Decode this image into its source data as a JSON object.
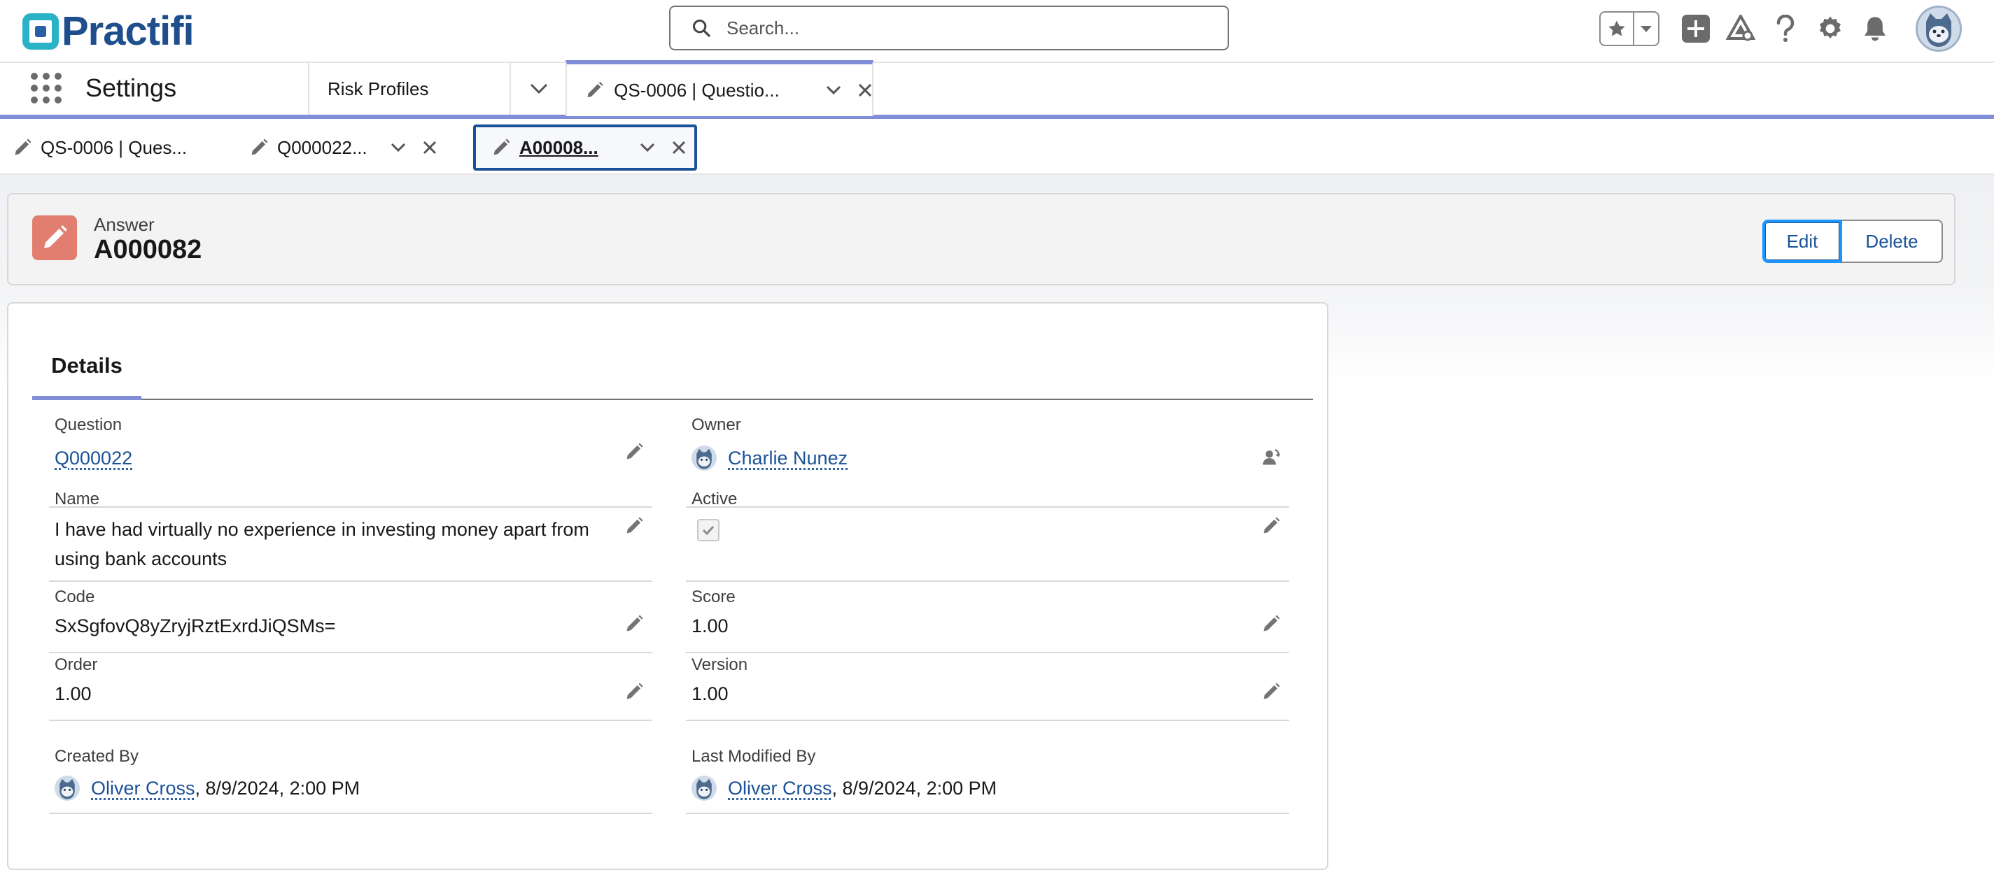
{
  "header": {
    "logo_text": "Practifi",
    "search": {
      "placeholder": "Search..."
    },
    "icons": [
      "favorites-star-icon",
      "favorites-dropdown-icon",
      "global-add-icon",
      "trailhead-icon",
      "help-icon",
      "setup-gear-icon",
      "notifications-bell-icon",
      "user-avatar"
    ]
  },
  "nav": {
    "app_name": "Settings",
    "risk_profiles_label": "Risk Profiles",
    "workspace_tab_label": "QS-0006 | Questio..."
  },
  "subtabs": [
    {
      "label": "QS-0006 | Ques..."
    },
    {
      "label": "Q000022..."
    },
    {
      "label": "A00008..."
    }
  ],
  "record": {
    "object_type": "Answer",
    "title": "A000082",
    "accent_color": "#e27e6f",
    "buttons": {
      "edit": "Edit",
      "delete": "Delete"
    }
  },
  "details": {
    "tab_label": "Details",
    "fields": {
      "question": {
        "label": "Question",
        "value": "Q000022"
      },
      "owner": {
        "label": "Owner",
        "value": "Charlie Nunez"
      },
      "name": {
        "label": "Name",
        "value": "I have had virtually no experience in investing money apart from using bank accounts"
      },
      "active": {
        "label": "Active",
        "checked": true
      },
      "code": {
        "label": "Code",
        "value": "SxSgfovQ8yZryjRztExrdJiQSMs="
      },
      "score": {
        "label": "Score",
        "value": "1.00"
      },
      "order": {
        "label": "Order",
        "value": "1.00"
      },
      "version": {
        "label": "Version",
        "value": "1.00"
      },
      "created_by": {
        "label": "Created By",
        "user": "Oliver Cross",
        "date": ", 8/9/2024, 2:00 PM"
      },
      "last_modified_by": {
        "label": "Last Modified By",
        "user": "Oliver Cross",
        "date": ", 8/9/2024, 2:00 PM"
      }
    }
  }
}
